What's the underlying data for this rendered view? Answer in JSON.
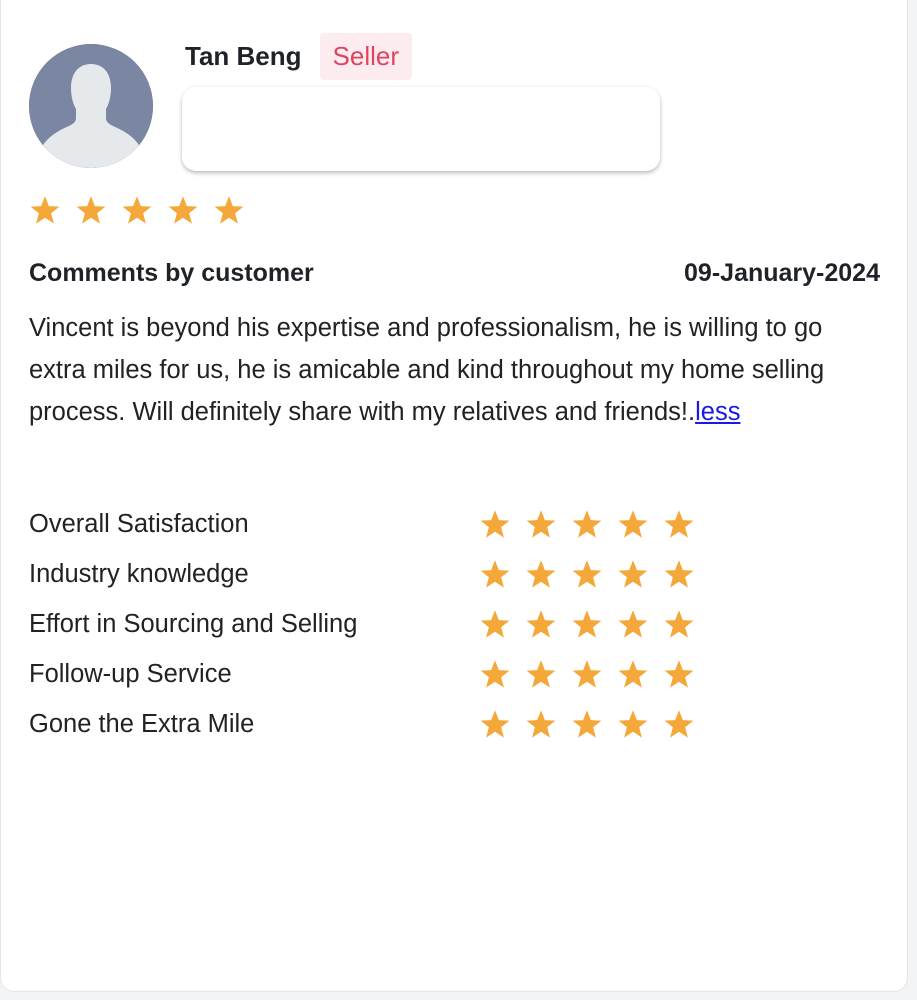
{
  "reviewer": {
    "name": "Tan Beng",
    "role_badge": "Seller",
    "avatar_icon": "user-silhouette-icon",
    "overall_rating": 5,
    "rating_max": 5
  },
  "comment": {
    "heading": "Comments by customer",
    "date": "09-January-2024",
    "text": "Vincent is beyond his expertise and professionalism, he is willing to go extra miles for us, he is amicable and kind throughout my home selling process. Will definitely share with my relatives and friends!.",
    "toggle_label": "less"
  },
  "ratings": [
    {
      "label": "Overall Satisfaction",
      "value": 5
    },
    {
      "label": "Industry knowledge",
      "value": 5
    },
    {
      "label": "Effort in Sourcing and Selling",
      "value": 5
    },
    {
      "label": "Follow-up Service",
      "value": 5
    },
    {
      "label": "Gone the Extra Mile",
      "value": 5
    }
  ],
  "colors": {
    "star": "#f4a83a",
    "badge_text": "#e0435e",
    "badge_bg": "#fcecef",
    "link": "#1a1ae6",
    "avatar_bg": "#7b86a2"
  }
}
